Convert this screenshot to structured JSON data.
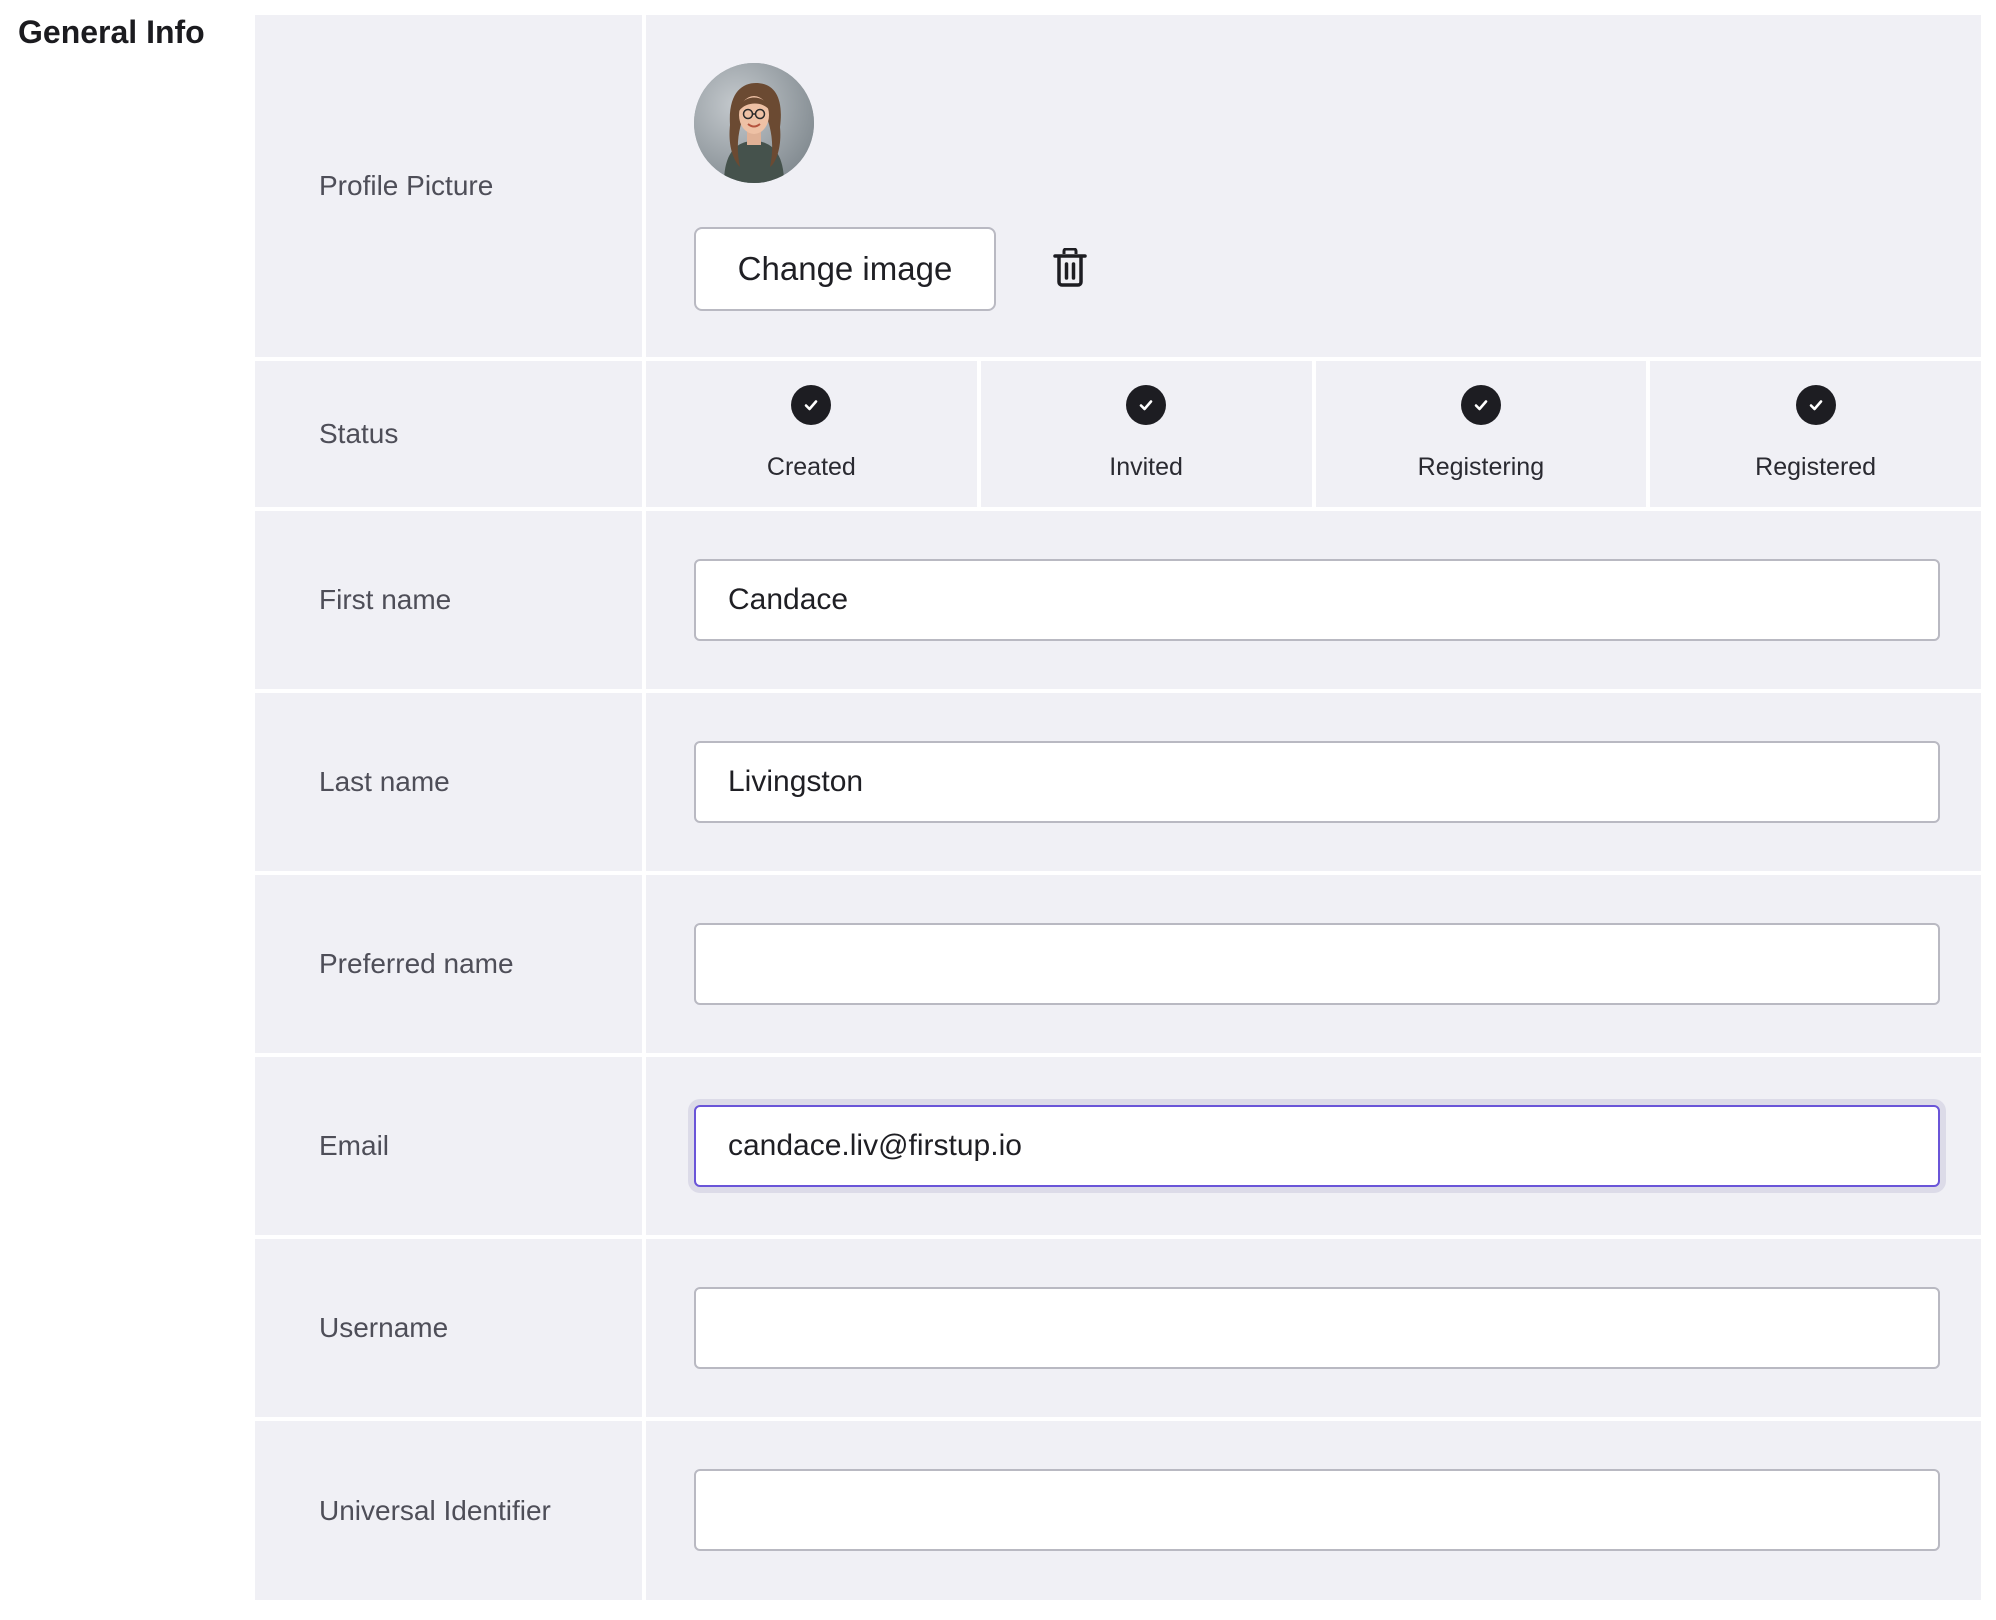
{
  "section": {
    "title": "General Info"
  },
  "profile": {
    "label": "Profile Picture",
    "change_button": "Change image",
    "avatar_icon": "user-avatar",
    "delete_icon": "trash-icon"
  },
  "status": {
    "label": "Status",
    "steps": [
      {
        "label": "Created",
        "completed": true
      },
      {
        "label": "Invited",
        "completed": true
      },
      {
        "label": "Registering",
        "completed": true
      },
      {
        "label": "Registered",
        "completed": true
      }
    ]
  },
  "fields": {
    "first_name": {
      "label": "First name",
      "value": "Candace"
    },
    "last_name": {
      "label": "Last name",
      "value": "Livingston"
    },
    "preferred_name": {
      "label": "Preferred name",
      "value": ""
    },
    "email": {
      "label": "Email",
      "value": "candace.liv@firstup.io",
      "focused": true
    },
    "username": {
      "label": "Username",
      "value": ""
    },
    "universal_identifier": {
      "label": "Universal Identifier",
      "value": ""
    }
  },
  "colors": {
    "panel_bg": "#f0f0f5",
    "focus_border": "#6a55d8",
    "check_bg": "#1d1d22"
  }
}
